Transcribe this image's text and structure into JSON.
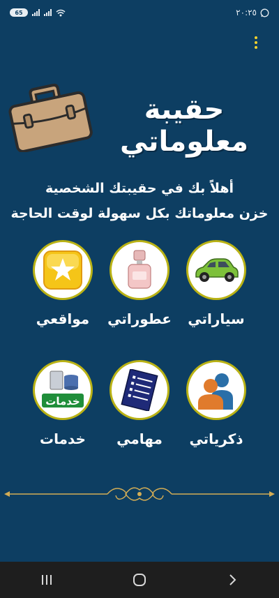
{
  "status_bar": {
    "time": "٢٠:٢٥",
    "battery": "65",
    "network": "LTE"
  },
  "header": {
    "menu_icon": "more-vert-icon",
    "app_logo_icon": "briefcase-icon",
    "app_title": "حقيبة معلوماتي"
  },
  "welcome": {
    "line1": "أهلاً بك في حقيبتك الشخصية",
    "line2": "خزن معلوماتك بكل سهولة لوقت الحاجة"
  },
  "tiles": [
    {
      "label": "سياراتي",
      "icon": "car-icon"
    },
    {
      "label": "عطوراتي",
      "icon": "perfume-icon"
    },
    {
      "label": "مواقعي",
      "icon": "star-icon"
    },
    {
      "label": "ذكرياتي",
      "icon": "people-icon"
    },
    {
      "label": "مهامي",
      "icon": "checklist-icon"
    },
    {
      "label": "خدمات",
      "icon": "services-icon"
    }
  ],
  "services_icon_text": "خدمات",
  "nav_bar": {
    "recent_icon": "recent-apps-icon",
    "home_icon": "home-icon",
    "back_icon": "back-icon"
  },
  "colors": {
    "background": "#0d3e62",
    "tile_border": "#b9b215",
    "menu_dots": "#f2d22e",
    "nav_bar": "#1e1e1e"
  }
}
